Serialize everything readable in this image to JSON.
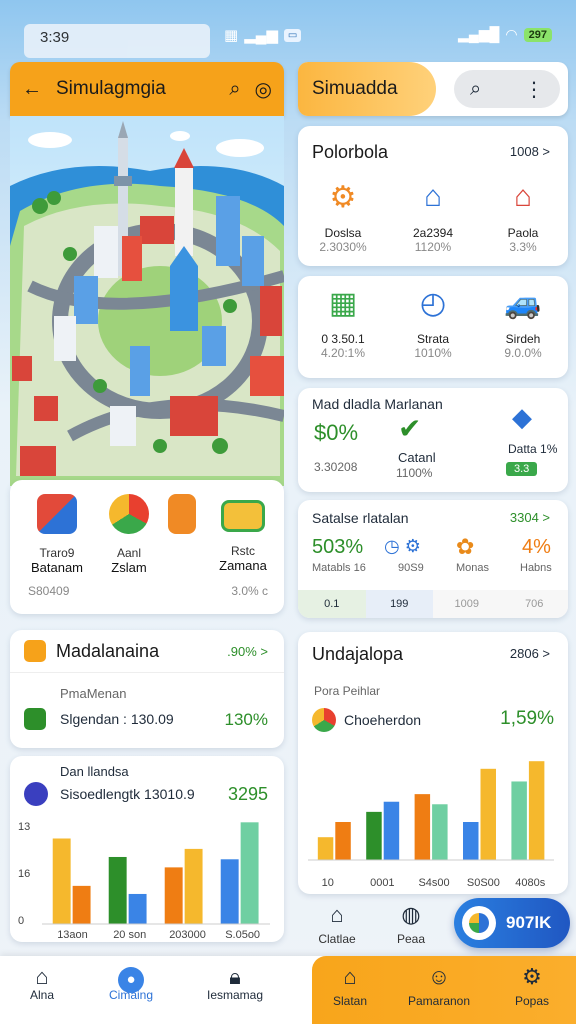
{
  "status": {
    "time": "3:39",
    "battery": "297"
  },
  "left_app": {
    "title": "Simulagmgia"
  },
  "right_app": {
    "title": "Simuadda"
  },
  "shortcuts": {
    "items": [
      {
        "l1": "Traro9",
        "l2": "Batanam"
      },
      {
        "l1": "Aanl",
        "l2": "Zslam"
      },
      {
        "l1": "Rstc",
        "l2": "Zamana"
      }
    ],
    "foot_left": "S80409",
    "foot_right": "3.0% c"
  },
  "portfolio": {
    "title": "Polorbola",
    "link": "1008 >",
    "cells": [
      {
        "a": "Doslsa",
        "b": "2.3030%"
      },
      {
        "a": "2a2394",
        "b": "1120%"
      },
      {
        "a": "Paola",
        "b": "3.3%"
      }
    ]
  },
  "stats2": {
    "cells": [
      {
        "a": "0 3.50.1",
        "b": "4.20:1%"
      },
      {
        "a": "Strata",
        "b": "1010%"
      },
      {
        "a": "Sirdeh",
        "b": "9.0.0%"
      }
    ]
  },
  "market": {
    "title": "Mad dladla Marlanan",
    "big_value": "$0%",
    "left_caption": "3.30208",
    "mid_label": "Catanl",
    "mid_sub": "1100%",
    "right_label": "Datta 1%",
    "badge": "3.3"
  },
  "sales": {
    "title": "Satalse rlatalan",
    "link": "3304 >",
    "cells": [
      {
        "v": "503%",
        "l": "Matabls 16"
      },
      {
        "v": "",
        "l": "90S9"
      },
      {
        "v": "",
        "l": "Monas"
      },
      {
        "v": "4%",
        "l": "Habns"
      }
    ],
    "footer": [
      "0.1",
      "199",
      "1009",
      "706"
    ]
  },
  "mad": {
    "title": "Madalanaina",
    "link": ".90% >",
    "sub": "PmaMenan",
    "row_label": "Slgendan : 130.09",
    "row_value": "130%"
  },
  "dan": {
    "title": "Dan llandsa",
    "row_label": "Sisoedlengtk 13010.9",
    "row_value": "3295",
    "y_ticks": [
      "13",
      "16",
      "0"
    ],
    "x_labels": [
      "13aon",
      "20 son",
      "203000",
      "S.05o0"
    ]
  },
  "under": {
    "title": "Undajalopa",
    "link": "2806 >",
    "sub": "Pora Peihlar",
    "row_label": "Choeherdon",
    "row_value": "1,59%",
    "x_labels": [
      "10",
      "0001",
      "S4s00",
      "S0S00",
      "4080s"
    ]
  },
  "fab": {
    "label": "907lK"
  },
  "nav": [
    {
      "label": "Alna",
      "icon": "home-icon"
    },
    {
      "label": "Cimaing",
      "icon": "profile-icon"
    },
    {
      "label": "Iesmamag",
      "icon": "lock-icon"
    },
    {
      "label": "Clatlae",
      "icon": "house-icon"
    },
    {
      "label": "Peaa",
      "icon": "globe-icon"
    },
    {
      "label": "Slatan",
      "icon": "home-icon"
    },
    {
      "label": "Pamaranon",
      "icon": "face-icon"
    },
    {
      "label": "Popas",
      "icon": "gear-icon"
    }
  ],
  "chart_data": [
    {
      "type": "bar",
      "categories": [
        "13aon",
        "20 son",
        "203000",
        "S.05o0"
      ],
      "series": [
        {
          "values": [
            74,
            58,
            49,
            56
          ]
        },
        {
          "values": [
            33,
            26,
            65,
            88
          ]
        }
      ],
      "ylim": [
        0,
        90
      ]
    },
    {
      "type": "bar",
      "categories": [
        "10",
        "0001",
        "S4s00",
        "S0S00",
        "4080s"
      ],
      "series": [
        {
          "values": [
            18,
            38,
            52,
            30,
            62
          ]
        },
        {
          "values": [
            30,
            46,
            44,
            72,
            78
          ]
        }
      ],
      "ylim": [
        0,
        90
      ]
    }
  ],
  "colors": {
    "accent": "#f6a21a",
    "blue": "#3a84e6",
    "green": "#2d8f2a",
    "orange": "#ef7d13"
  }
}
